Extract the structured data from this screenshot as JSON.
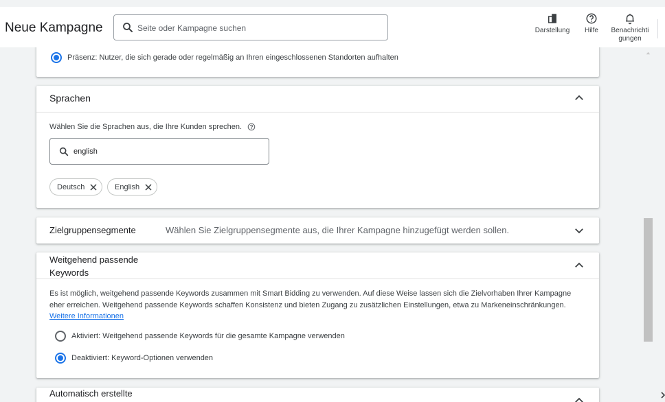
{
  "header": {
    "title": "Neue Kampagne",
    "search_placeholder": "Seite oder Kampagne suchen",
    "actions": [
      {
        "label": "Darstellung",
        "icon": "appearance-icon"
      },
      {
        "label": "Hilfe",
        "icon": "help-icon"
      },
      {
        "label_line1": "Benachrichti",
        "label_line2": "gungen",
        "icon": "bell-icon"
      }
    ]
  },
  "location_card": {
    "radio_label": "Präsenz: Nutzer, die sich gerade oder regelmäßig an Ihren eingeschlossenen Standorten aufhalten",
    "checked": true
  },
  "languages_card": {
    "title": "Sprachen",
    "hint": "Wählen Sie die Sprachen aus, die Ihre Kunden sprechen.",
    "search_value": "english",
    "chips": [
      "Deutsch",
      "English"
    ]
  },
  "audience_card": {
    "title": "Zielgruppensegmente",
    "description": "Wählen Sie Zielgruppensegmente aus, die Ihrer Kampagne hinzugefügt werden sollen."
  },
  "broad_match_card": {
    "title_line1": "Weitgehend passende",
    "title_line2": "Keywords",
    "description": "Es ist möglich, weitgehend passende Keywords zusammen mit Smart Bidding zu verwenden. Auf diese Weise lassen sich die Zielvorhaben Ihrer Kampagne eher erreichen. Weitgehend passende Keywords schaffen Konsistenz und bieten Zugang zu zusätzlichen Einstellungen, etwa zu Markeneinschränkungen.",
    "link": "Weitere Informationen",
    "options": [
      {
        "label": "Aktiviert: Weitgehend passende Keywords für die gesamte Kampagne verwenden",
        "checked": false
      },
      {
        "label": "Deaktiviert: Keyword-Optionen verwenden",
        "checked": true
      }
    ]
  },
  "auto_assets_card": {
    "title": "Automatisch erstellte"
  },
  "colors": {
    "accent": "#1a73e8",
    "background": "#f1f3f4",
    "card": "#ffffff"
  }
}
